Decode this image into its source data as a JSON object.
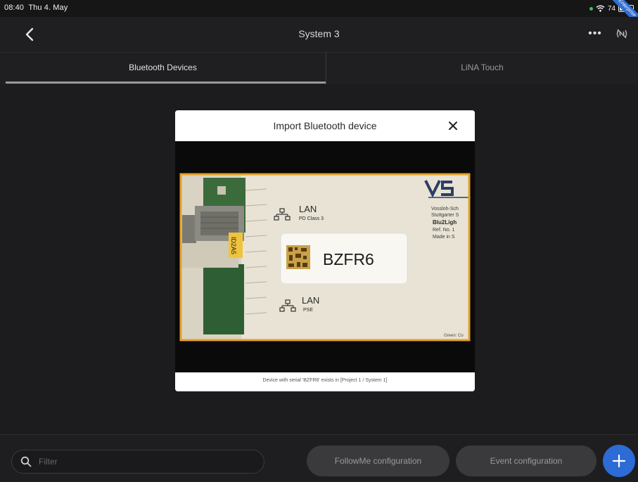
{
  "status_bar": {
    "time": "08:40",
    "date": "Thu 4. May",
    "battery_percent": "74",
    "corner_ribbon": "Enterprise"
  },
  "nav": {
    "title": "System 3",
    "back_icon": "chevron-left-icon",
    "more_icon": "more-horizontal-icon",
    "signal_icon": "signal-off-icon"
  },
  "tabs": [
    {
      "label": "Bluetooth Devices",
      "active": true
    },
    {
      "label": "LiNA Touch",
      "active": false
    }
  ],
  "modal": {
    "title": "Import Bluetooth device",
    "close_icon": "close-icon",
    "camera": {
      "brand_logo": "VS",
      "port_top_label": "LAN",
      "port_top_sub": "PD Class 3",
      "port_bottom_label": "LAN",
      "port_bottom_sub": "PSE",
      "serial_sticker": "BZFR6",
      "side_label": "ID2A5",
      "nameplate_lines": [
        "Vossloh-Sch",
        "Stuttgarter S",
        "Blu2Ligh",
        "Ref. No. 1",
        "Made in S"
      ],
      "bottom_text": "Green: Co"
    },
    "message": "Device with serial 'BZFR6' exists in [Project 1 / System 1]"
  },
  "bottom_bar": {
    "filter": {
      "placeholder": "Filter",
      "value": "",
      "icon": "search-icon"
    },
    "followme_label": "FollowMe configuration",
    "event_label": "Event configuration",
    "add_icon": "plus-icon"
  },
  "colors": {
    "background": "#1c1c1e",
    "accent": "#2d6bd6",
    "scan_frame": "#e5a32b",
    "status_green": "#34c759"
  }
}
